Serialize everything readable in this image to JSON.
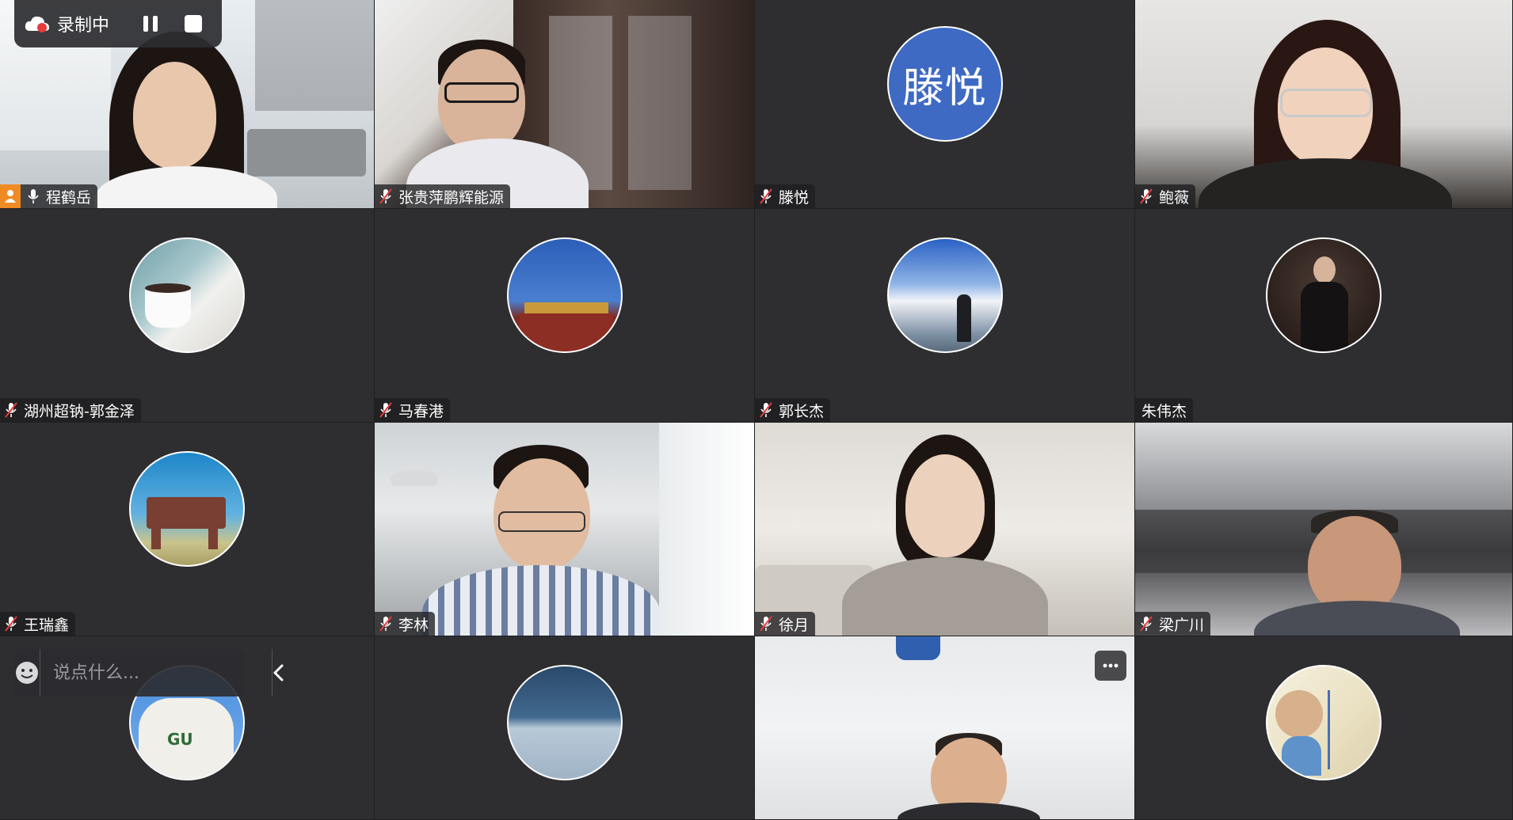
{
  "recording": {
    "label": "录制中",
    "accent": "#e83b3b"
  },
  "chat": {
    "placeholder": "说点什么..."
  },
  "participants": [
    {
      "name": "程鹤岳",
      "type": "video",
      "host": true,
      "muted": false
    },
    {
      "name": "张贵萍鹏辉能源",
      "type": "video",
      "muted": true
    },
    {
      "name": "滕悦",
      "type": "avatar-text",
      "avatar_text": "滕悦",
      "muted": true
    },
    {
      "name": "鲍薇",
      "type": "video",
      "muted": true
    },
    {
      "name": "湖州超钠-郭金泽",
      "type": "avatar-image",
      "avatar_icon": "coffee-cup-photo",
      "muted": true
    },
    {
      "name": "马春港",
      "type": "avatar-image",
      "avatar_icon": "gate-tower-photo",
      "muted": true
    },
    {
      "name": "郭长杰",
      "type": "avatar-image",
      "avatar_icon": "sky-person-photo",
      "muted": true
    },
    {
      "name": "朱伟杰",
      "type": "avatar-image",
      "avatar_icon": "suit-person-photo",
      "muted": false
    },
    {
      "name": "王瑞鑫",
      "type": "avatar-image",
      "avatar_icon": "clothes-cow-photo",
      "muted": true
    },
    {
      "name": "李林",
      "type": "video",
      "muted": true
    },
    {
      "name": "徐月",
      "type": "video",
      "muted": true
    },
    {
      "name": "梁广川",
      "type": "video",
      "muted": true
    },
    {
      "name": "",
      "type": "avatar-image",
      "avatar_icon": "hoodie-person-photo"
    },
    {
      "name": "",
      "type": "avatar-image",
      "avatar_icon": "ocean-photo"
    },
    {
      "name": "",
      "type": "video"
    },
    {
      "name": "",
      "type": "avatar-image",
      "avatar_icon": "birthday-card-photo"
    }
  ],
  "colors": {
    "tile_bg": "#2e2e31",
    "avatar_blue": "#3e6ac4",
    "host_orange": "#f08a24"
  }
}
